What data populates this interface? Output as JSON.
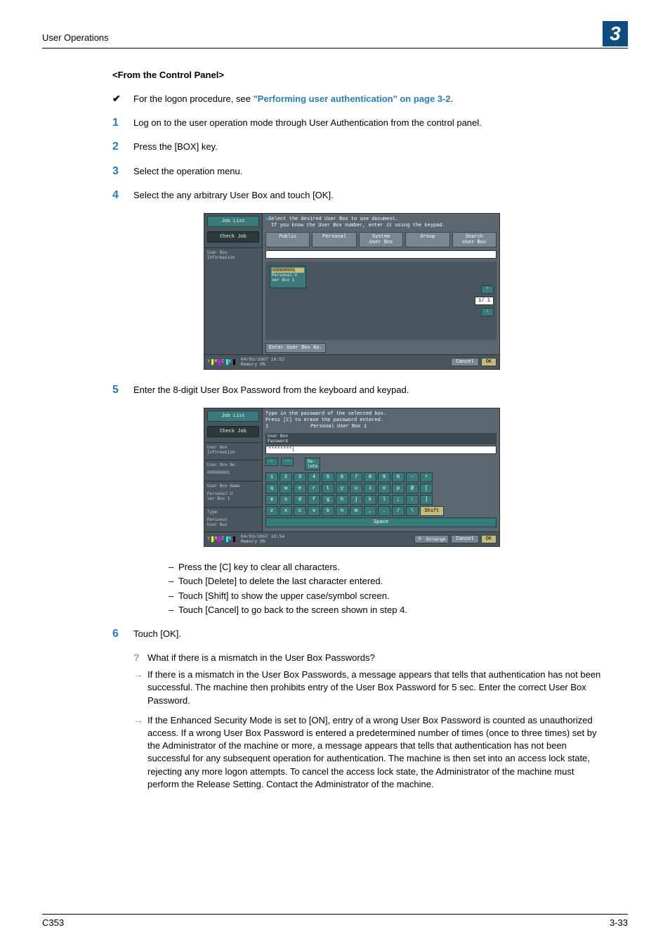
{
  "header": {
    "title": "User Operations",
    "chapter": "3"
  },
  "section_heading": "<From the Control Panel>",
  "check_line": {
    "prefix": "For the logon procedure, see ",
    "link": "\"Performing user authentication\" on page 3-2",
    "suffix": "."
  },
  "steps": {
    "1": "Log on to the user operation mode through User Authentication from the control panel.",
    "2": "Press the [BOX] key.",
    "3": "Select the operation menu.",
    "4": "Select the any arbitrary User Box and touch [OK].",
    "5": "Enter the 8-digit User Box Password from the keyboard and keypad.",
    "6": "Touch [OK]."
  },
  "shot1": {
    "left": {
      "job_list": "Job List",
      "check_job": "Check Job",
      "info": "User Box\nInformation"
    },
    "msg1": "Select the desired User Box to use document.",
    "msg2": "If you know the User Box number, enter it using the keypad.",
    "tabs": [
      "Public",
      "Personal",
      "System\nUser Box",
      "Group",
      "Search\nUser Box"
    ],
    "box": {
      "num": "000000001",
      "name": "Personal U\nser Box 1"
    },
    "pager": "1/ 1",
    "enter": "Enter User Box No.",
    "datetime": "04/03/2007   16:52\nMemory        0%",
    "cancel": "Cancel",
    "ok": "OK"
  },
  "shot2": {
    "left": {
      "job_list": "Job List",
      "check_job": "Check Job",
      "info": "User Box\nInformation",
      "no_label": "User Box No.",
      "no_val": "000000001",
      "name_label": "User Box Name",
      "name_val": "Personal U\nser Box 1",
      "type_label": "Type",
      "type_val": "Personal\nUser Box"
    },
    "msg1": "Type in the password of the selected box.",
    "msg2": "Press [C] to erase the password entered.",
    "subt": "Personal User Box 1",
    "strip": "User Box\nPassword",
    "masked": "********|",
    "delete": "De-\nlete",
    "row1": [
      "1",
      "2",
      "3",
      "4",
      "5",
      "6",
      "7",
      "8",
      "9",
      "0",
      "-",
      "^"
    ],
    "row2": [
      "q",
      "w",
      "e",
      "r",
      "t",
      "y",
      "u",
      "i",
      "o",
      "p",
      "@",
      "["
    ],
    "row3": [
      "a",
      "s",
      "d",
      "f",
      "g",
      "h",
      "j",
      "k",
      "l",
      ";",
      ":",
      "]"
    ],
    "row4": [
      "z",
      "x",
      "c",
      "v",
      "b",
      "n",
      "m",
      ",",
      ".",
      "/",
      "\\"
    ],
    "shift": "Shift",
    "space": "Space",
    "enlarge": "Enlarge",
    "datetime": "04/03/2007   16:54\nMemory        0%",
    "cancel": "Cancel",
    "ok": "OK"
  },
  "notes": [
    "Press the [C] key to clear all characters.",
    "Touch [Delete] to delete the last character entered.",
    "Touch [Shift] to show the upper case/symbol screen.",
    "Touch [Cancel] to go back to the screen shown in step 4."
  ],
  "qa": {
    "q": "What if there is a mismatch in the User Box Passwords?",
    "a1": "If there is a mismatch in the User Box Passwords, a message appears that tells that authentication has not been successful. The machine then prohibits entry of the User Box Password for 5 sec. Enter the correct User Box Password.",
    "a2": "If the Enhanced Security Mode is set to [ON], entry of a wrong User Box Password is counted as unauthorized access. If a wrong User Box Password is entered a predetermined number of times (once to three times) set by the Administrator of the machine or more, a message appears that tells that authentication has not been successful for any subsequent operation for authentication. The machine is then set into an access lock state, rejecting any more logon attempts. To cancel the access lock state, the Administrator of the machine must perform the Release Setting. Contact the Administrator of the machine."
  },
  "footer": {
    "left": "C353",
    "right": "3-33"
  }
}
